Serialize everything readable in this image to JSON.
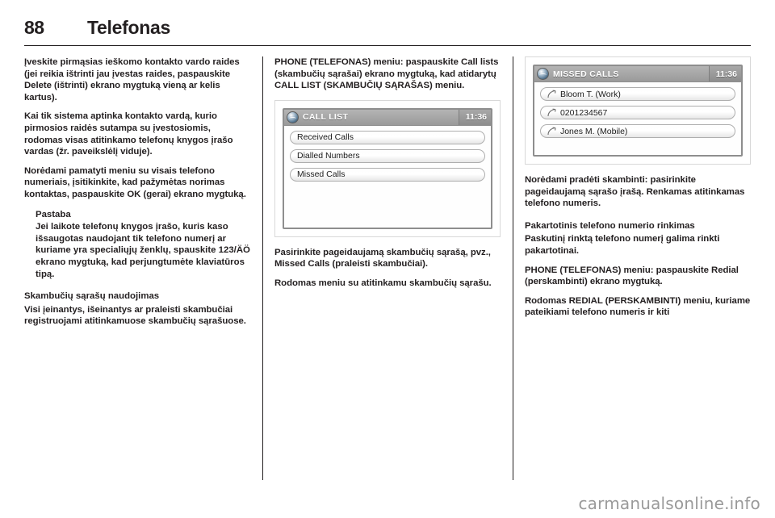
{
  "header": {
    "page_number": "88",
    "title": "Telefonas"
  },
  "watermark": "carmanualsonline.info",
  "left_column": {
    "p1": "Įveskite pirmąsias ieškomo kontakto vardo raides (jei reikia ištrinti jau įvestas raides, paspauskite Delete (ištrinti) ekrano mygtuką vieną ar kelis kartus).",
    "p2": "Kai tik sistema aptinka kontakto vardą, kurio pirmosios raidės sutampa su įvestosiomis, rodomas visas atitinkamo telefonų knygos įrašo vardas (žr. paveikslėlį viduje).",
    "p3": "Norėdami pamatyti meniu su visais telefono numeriais, įsitikinkite, kad pažymėtas norimas kontaktas, paspauskite OK (gerai) ekrano mygtuką.",
    "note_title": "Pastaba",
    "note_body": "Jei laikote telefonų knygos įrašo, kuris kaso išsaugotas naudojant tik telefono numerį ar kuriame yra specialiųjų ženklų, spauskite 123/ÄÖ ekrano mygtuką, kad perjungtumėte klaviatūros tipą.",
    "subhead": "Skambučių sąrašų naudojimas",
    "p4": "Visi įeinantys, išeinantys ar praleisti skambučiai registruojami atitinkamuose skambučių sąrašuose."
  },
  "middle_column": {
    "p1": "PHONE (TELEFONAS) meniu: paspauskite Call lists (skambučių sąrašai) ekrano mygtuką, kad atidarytų CALL LIST (SKAMBUČIŲ SĄRAŠAS) meniu.",
    "p2": "Pasirinkite pageidaujamą skambučių sąrašą, pvz., Missed Calls (praleisti skambučiai).",
    "p3": "Rodomas meniu su atitinkamu skambučių sąrašu.",
    "screen": {
      "icon": "globe-icon",
      "title": "CALL LIST",
      "clock": "11:36",
      "items": [
        {
          "label": "Received Calls"
        },
        {
          "label": "Dialled Numbers"
        },
        {
          "label": "Missed Calls"
        }
      ]
    }
  },
  "right_column": {
    "screen": {
      "icon": "globe-icon",
      "title": "MISSED CALLS",
      "clock": "11:36",
      "items": [
        {
          "icon": "call-arrow-icon",
          "label": "Bloom T. (Work)"
        },
        {
          "icon": "call-arrow-icon",
          "label": "0201234567"
        },
        {
          "icon": "call-arrow-icon",
          "label": "Jones M. (Mobile)"
        }
      ]
    },
    "p1": "Norėdami pradėti skambinti: pasirinkite pageidaujamą sąrašo įrašą. Renkamas atitinkamas telefono numeris.",
    "subhead": "Pakartotinis telefono numerio rinkimas",
    "p2": "Paskutinį rinktą telefono numerį galima rinkti pakartotinai.",
    "p3": "PHONE (TELEFONAS) meniu: paspauskite Redial (perskambinti) ekrano mygtuką.",
    "p4": "Rodomas REDIAL (PERSKAMBINTI) meniu, kuriame pateikiami telefono numeris ir kiti"
  },
  "colors": {
    "text": "#231f20",
    "rule": "#231f20",
    "screen_titlebar": "#9a9a9a",
    "watermark": "#9a9a9a"
  }
}
